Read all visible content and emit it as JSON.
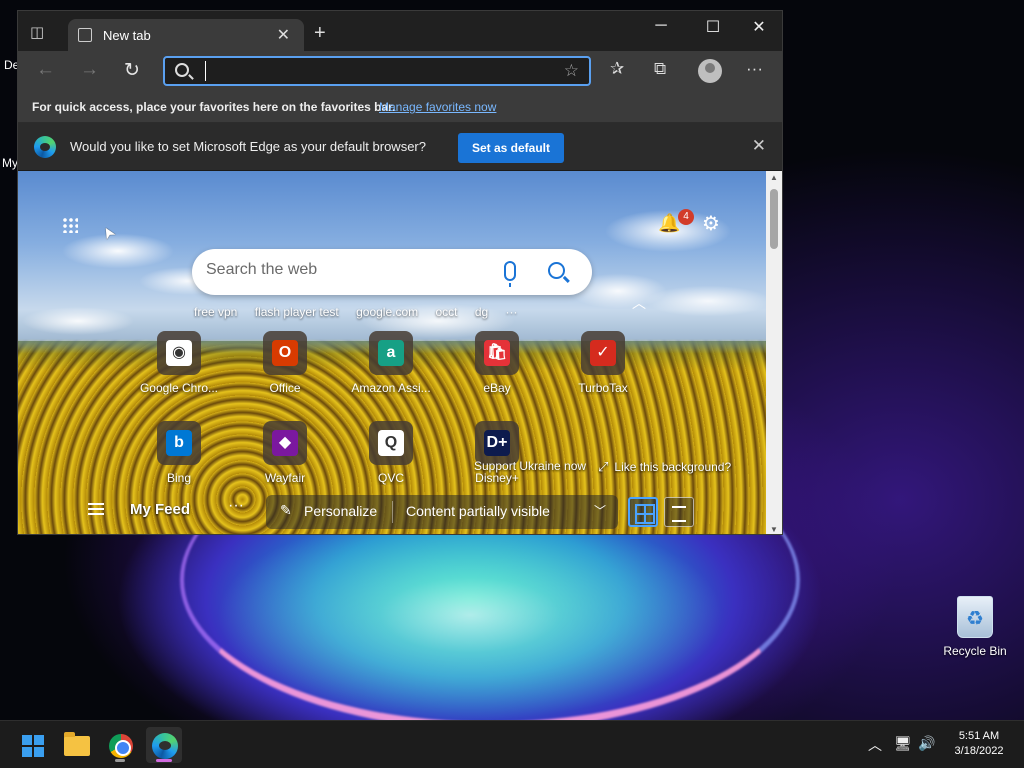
{
  "desktop": {
    "partial_labels": [
      "De",
      "My"
    ],
    "recycle_bin_label": "Recycle Bin"
  },
  "browser": {
    "tab": {
      "title": "New tab"
    },
    "window_controls": {
      "minimize": "─",
      "maximize": "☐",
      "close": "✕"
    },
    "toolbar": {
      "address_value": "",
      "address_placeholder": ""
    },
    "favorites_bar": {
      "text": "For quick access, place your favorites here on the favorites bar.",
      "link": "Manage favorites now"
    },
    "infobar": {
      "message": "Would you like to set Microsoft Edge as your default browser?",
      "button": "Set as default"
    }
  },
  "newtab": {
    "notification_count": "4",
    "search_placeholder": "Search the web",
    "quick_searches": [
      "free vpn",
      "flash player test",
      "google.com",
      "occt",
      "dg",
      "···"
    ],
    "tiles": [
      {
        "label": "Google Chro...",
        "icon": "chrome-icon",
        "color": "#ffffff"
      },
      {
        "label": "Office",
        "icon": "office-icon",
        "color": "#d83b01"
      },
      {
        "label": "Amazon Assi...",
        "icon": "amazon-assistant-icon",
        "color": "#16a085"
      },
      {
        "label": "eBay",
        "icon": "ebay-icon",
        "color": "#e53238"
      },
      {
        "label": "TurboTax",
        "icon": "turbotax-icon",
        "color": "#d52b1e"
      },
      {
        "label": "Bing",
        "icon": "bing-icon",
        "color": "#0078d4"
      },
      {
        "label": "Wayfair",
        "icon": "wayfair-icon",
        "color": "#7b189f"
      },
      {
        "label": "QVC",
        "icon": "qvc-icon",
        "color": "#ffffff"
      },
      {
        "label": "Disney+",
        "icon": "disney-plus-icon",
        "color": "#0e1b4d"
      }
    ],
    "tile_glyphs": [
      "◉",
      "O",
      "a",
      "🛍",
      "✓",
      "b",
      "◆",
      "Q",
      "D+"
    ],
    "support_ukraine": "Support Ukraine now",
    "like_background": "Like this background?",
    "feed": {
      "title": "My Feed",
      "more": "···",
      "personalize": "Personalize",
      "visibility": "Content partially visible"
    }
  },
  "taskbar": {
    "time": "5:51 AM",
    "date": "3/18/2022"
  }
}
